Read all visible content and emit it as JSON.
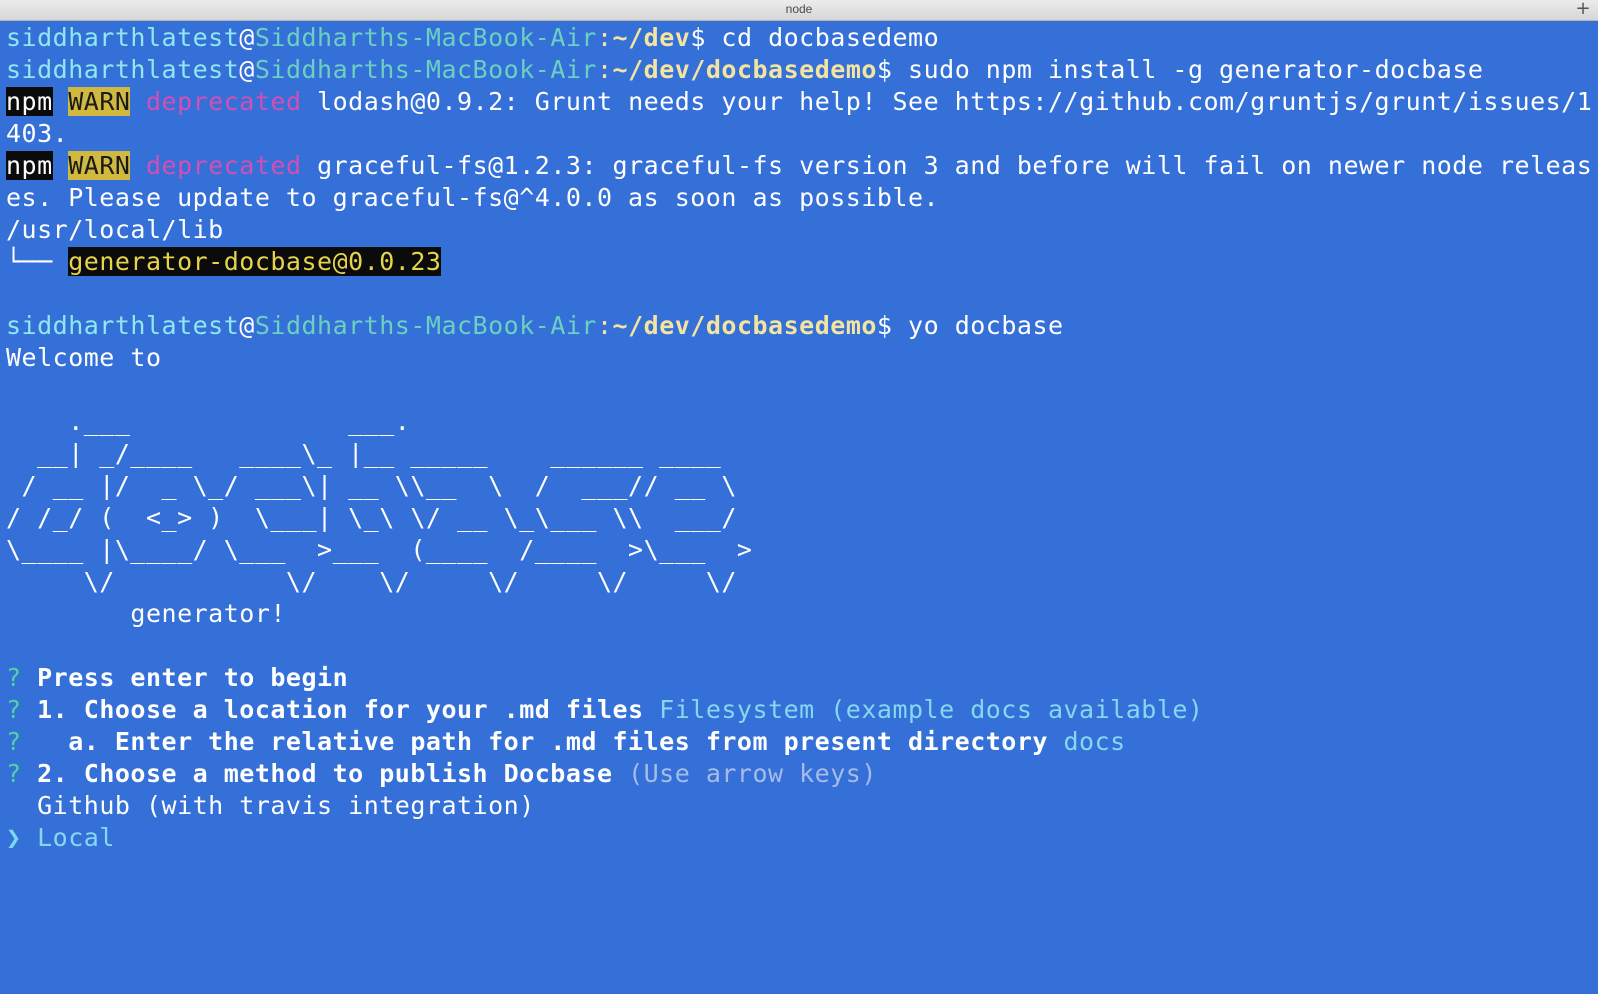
{
  "window": {
    "title": "node",
    "new_tab_label": "+"
  },
  "terminal": {
    "prompt1": {
      "user": "siddharthlatest",
      "at": "@",
      "host": "Siddharths-MacBook-Air",
      "colon": ":",
      "path": "~/dev",
      "dollar": "$",
      "command": " cd docbasedemo"
    },
    "prompt2": {
      "user": "siddharthlatest",
      "at": "@",
      "host": "Siddharths-MacBook-Air",
      "colon": ":",
      "path": "~/dev/docbasedemo",
      "dollar": "$",
      "command": " sudo npm install -g generator-docbase"
    },
    "warn1": {
      "npm": "npm",
      "warn": "WARN",
      "deprecated": "deprecated",
      "msg_line1": " lodash@0.9.2: Grunt needs your help! See https://github.com/gruntjs/grunt/issues/1",
      "msg_line2": "403."
    },
    "warn2": {
      "npm": "npm",
      "warn": "WARN",
      "deprecated": "deprecated",
      "msg_line1": " graceful-fs@1.2.3: graceful-fs version 3 and before will fail on newer node releas",
      "msg_line2": "es. Please update to graceful-fs@^4.0.0 as soon as possible."
    },
    "install_path": "/usr/local/lib",
    "tree_branch": "└── ",
    "installed_pkg": "generator-docbase@0.0.23",
    "prompt3": {
      "user": "siddharthlatest",
      "at": "@",
      "host": "Siddharths-MacBook-Air",
      "colon": ":",
      "path": "~/dev/docbasedemo",
      "dollar": "$",
      "command": " yo docbase"
    },
    "welcome": "Welcome to",
    "ascii_art": [
      "    .___              ___.",
      "  __| _/____   ____\\_ |__ _____    ______ ____",
      " / __ |/  _ \\_/ ___\\| __ \\\\__  \\  /  ___// __ \\",
      "/ /_/ (  <_> )  \\___| \\_\\ \\/ __ \\_\\___ \\\\  ___/",
      "\\____ |\\____/ \\___  >___  (____  /____  >\\___  >",
      "     \\/           \\/    \\/     \\/     \\/     \\/"
    ],
    "generator_text": "        generator!",
    "questions": [
      {
        "mark": "?",
        "text": " Press enter to begin",
        "answer": "",
        "hint": ""
      },
      {
        "mark": "?",
        "text": " 1. Choose a location for your .md files",
        "answer": " Filesystem (example docs available)",
        "hint": ""
      },
      {
        "mark": "?",
        "text": "   a. Enter the relative path for .md files from present directory",
        "answer": " docs",
        "hint": ""
      },
      {
        "mark": "?",
        "text": " 2. Choose a method to publish Docbase",
        "answer": "",
        "hint": " (Use arrow keys)"
      }
    ],
    "options": [
      {
        "pointer": " ",
        "label": " Github (with travis integration)"
      },
      {
        "pointer": "❯",
        "label": " Local"
      }
    ]
  }
}
